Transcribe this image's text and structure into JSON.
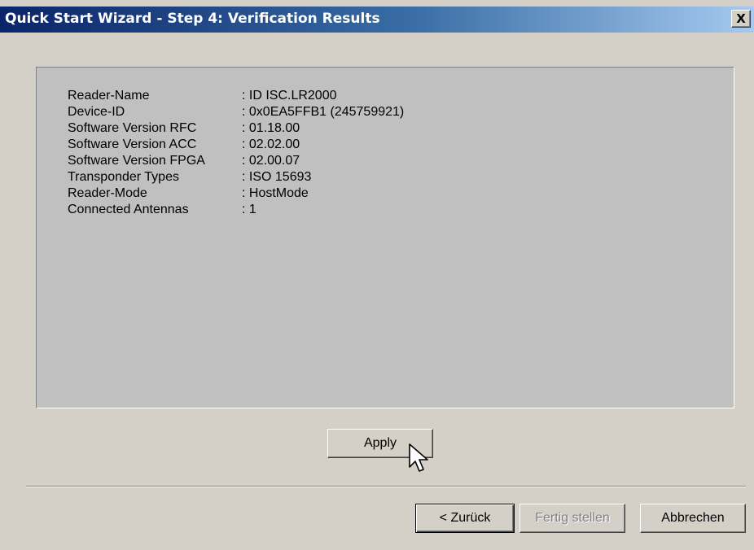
{
  "window": {
    "title": "Quick Start Wizard - Step 4: Verification Results",
    "close_label": "X"
  },
  "results": [
    {
      "label": "Reader-Name",
      "value": ": ID ISC.LR2000"
    },
    {
      "label": "Device-ID",
      "value": ": 0x0EA5FFB1 (245759921)"
    },
    {
      "label": "Software Version RFC",
      "value": ": 01.18.00"
    },
    {
      "label": "Software Version ACC",
      "value": ": 02.02.00"
    },
    {
      "label": "Software Version FPGA",
      "value": ": 02.00.07"
    },
    {
      "label": "Transponder Types",
      "value": ": ISO 15693"
    },
    {
      "label": "Reader-Mode",
      "value": ": HostMode"
    },
    {
      "label": "Connected Antennas",
      "value": ": 1"
    }
  ],
  "buttons": {
    "apply": "Apply",
    "back": "< Zurück",
    "finish": "Fertig stellen",
    "cancel": "Abbrechen"
  },
  "icons": {
    "close": "close-icon",
    "cursor": "mouse-pointer-icon"
  },
  "colors": {
    "titlebar_start": "#0a246a",
    "titlebar_end": "#a6caf0",
    "window_bg": "#d4d0c8",
    "panel_bg": "#c0c0c0"
  }
}
